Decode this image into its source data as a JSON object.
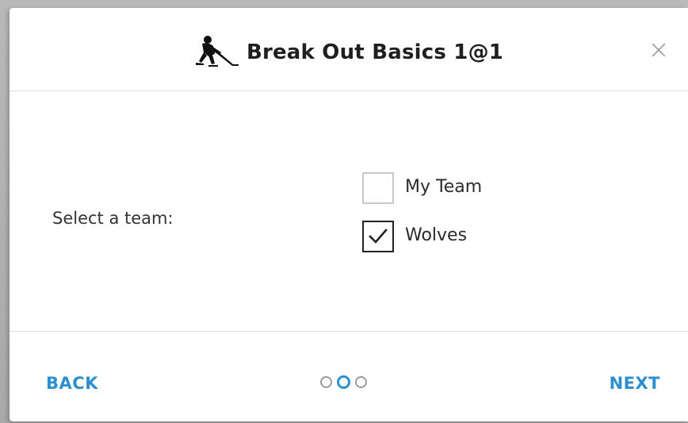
{
  "dialog": {
    "title": "Break Out Basics 1@1",
    "close_icon": "close-icon",
    "title_icon": "hockey-player-icon"
  },
  "form": {
    "label": "Select a team:",
    "options": [
      {
        "label": "My Team",
        "checked": false
      },
      {
        "label": "Wolves",
        "checked": true
      }
    ]
  },
  "footer": {
    "back_label": "BACK",
    "next_label": "NEXT",
    "steps_total": 3,
    "current_step": 2
  },
  "colors": {
    "accent": "#2c8fd0",
    "text": "#333333"
  }
}
